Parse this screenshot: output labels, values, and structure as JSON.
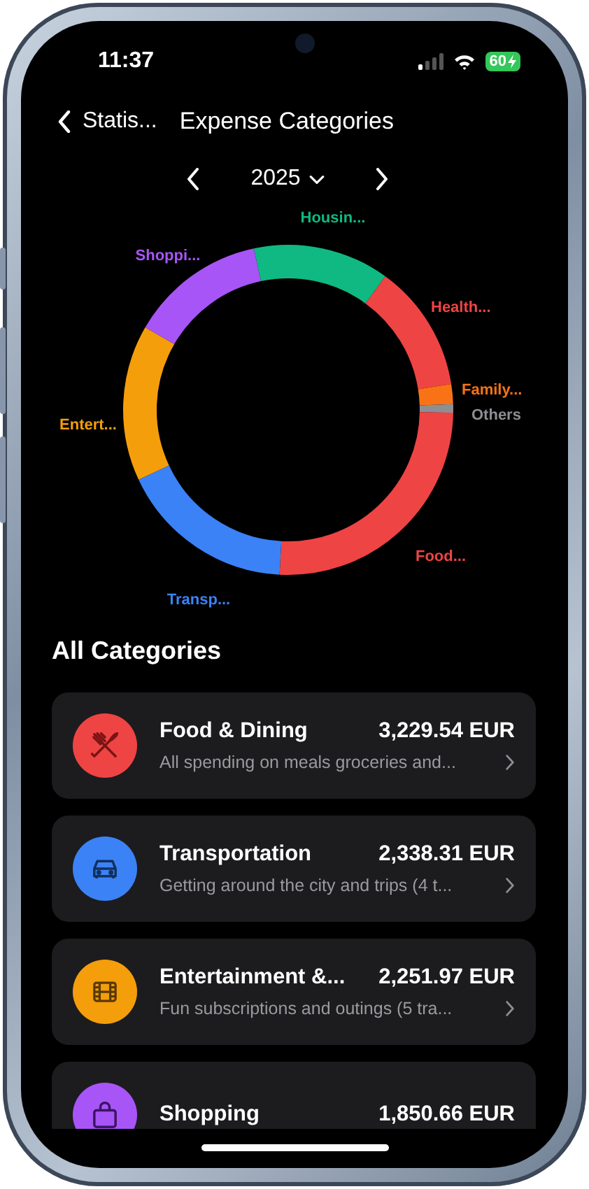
{
  "status_bar": {
    "time": "11:37",
    "battery": "60"
  },
  "nav": {
    "back_label": "Statis...",
    "title": "Expense Categories"
  },
  "year_picker": {
    "year": "2025"
  },
  "chart": {
    "segments": [
      {
        "label": "Housin...",
        "color": "#10b981"
      },
      {
        "label": "Health...",
        "color": "#ef4444"
      },
      {
        "label": "Family...",
        "color": "#f97316"
      },
      {
        "label": "Others",
        "color": "#8e8e93"
      },
      {
        "label": "Food...",
        "color": "#ef4444"
      },
      {
        "label": "Transp...",
        "color": "#3b82f6"
      },
      {
        "label": "Entert...",
        "color": "#f59e0b"
      },
      {
        "label": "Shoppi...",
        "color": "#a855f7"
      }
    ]
  },
  "section_title": "All Categories",
  "categories": [
    {
      "name": "Food & Dining",
      "amount": "3,229.54 EUR",
      "description": "All spending on meals groceries and...",
      "color": "#ef4444"
    },
    {
      "name": "Transportation",
      "amount": "2,338.31 EUR",
      "description": "Getting around the city and trips (4 t...",
      "color": "#3b82f6"
    },
    {
      "name": "Entertainment &...",
      "amount": "2,251.97 EUR",
      "description": "Fun subscriptions and outings (5 tra...",
      "color": "#f59e0b"
    },
    {
      "name": "Shopping",
      "amount": "1,850.66 EUR",
      "color": "#a855f7"
    }
  ]
}
